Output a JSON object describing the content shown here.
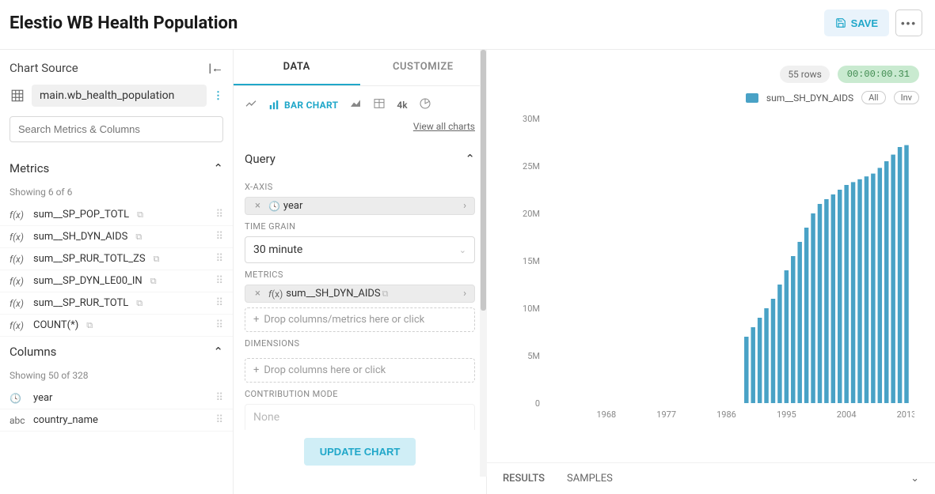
{
  "header": {
    "title": "Elestio WB Health Population",
    "save_label": "SAVE"
  },
  "chart_source": {
    "label": "Chart Source",
    "dataset": "main.wb_health_population"
  },
  "search": {
    "placeholder": "Search Metrics & Columns"
  },
  "metrics": {
    "label": "Metrics",
    "showing": "Showing 6 of 6",
    "items": [
      {
        "name": "sum__SP_POP_TOTL"
      },
      {
        "name": "sum__SH_DYN_AIDS"
      },
      {
        "name": "sum__SP_RUR_TOTL_ZS"
      },
      {
        "name": "sum__SP_DYN_LE00_IN"
      },
      {
        "name": "sum__SP_RUR_TOTL"
      },
      {
        "name": "COUNT(*)"
      }
    ]
  },
  "columns": {
    "label": "Columns",
    "showing": "Showing 50 of 328",
    "items": [
      {
        "name": "year",
        "type": "time"
      },
      {
        "name": "country_name",
        "type": "abc"
      }
    ]
  },
  "tabs": {
    "data": "DATA",
    "customize": "CUSTOMIZE"
  },
  "chart_types": {
    "bar_label": "BAR CHART",
    "four_k": "4k",
    "view_all": "View all charts"
  },
  "query": {
    "label": "Query",
    "xaxis_label": "X-AXIS",
    "xaxis_value": "year",
    "time_grain_label": "TIME GRAIN",
    "time_grain_value": "30 minute",
    "metrics_label": "METRICS",
    "metrics_value": "sum__SH_DYN_AIDS",
    "metrics_drop": "Drop columns/metrics here or click",
    "dimensions_label": "DIMENSIONS",
    "dimensions_drop": "Drop columns here or click",
    "contribution_label": "CONTRIBUTION MODE",
    "contribution_value": "None",
    "update_label": "UPDATE CHART"
  },
  "stats": {
    "rows": "55 rows",
    "time": "00:00:00.31"
  },
  "legend": {
    "series": "sum__SH_DYN_AIDS",
    "all": "All",
    "inv": "Inv"
  },
  "bottom": {
    "results": "RESULTS",
    "samples": "SAMPLES"
  },
  "chart_data": {
    "type": "bar",
    "title": "",
    "xlabel": "",
    "ylabel": "",
    "categories": [
      1989,
      1990,
      1991,
      1992,
      1993,
      1994,
      1995,
      1996,
      1997,
      1998,
      1999,
      2000,
      2001,
      2002,
      2003,
      2004,
      2005,
      2006,
      2007,
      2008,
      2009,
      2010,
      2011,
      2012,
      2013
    ],
    "values": [
      7.0,
      8.0,
      9.0,
      10.0,
      11.0,
      12.5,
      14.0,
      15.5,
      17.0,
      18.5,
      20.0,
      21.0,
      21.5,
      22.0,
      22.5,
      23.0,
      23.3,
      23.6,
      23.9,
      24.2,
      24.8,
      25.5,
      26.2,
      27.0,
      27.2
    ],
    "value_unit": "M",
    "ylim": [
      0,
      30
    ],
    "y_ticks": [
      0,
      5,
      10,
      15,
      20,
      25,
      30
    ],
    "x_ticks_shown": [
      1968,
      1977,
      1986,
      1995,
      2004,
      2013
    ],
    "x_domain": [
      1959,
      2013
    ],
    "series_color": "#49a2c6"
  }
}
